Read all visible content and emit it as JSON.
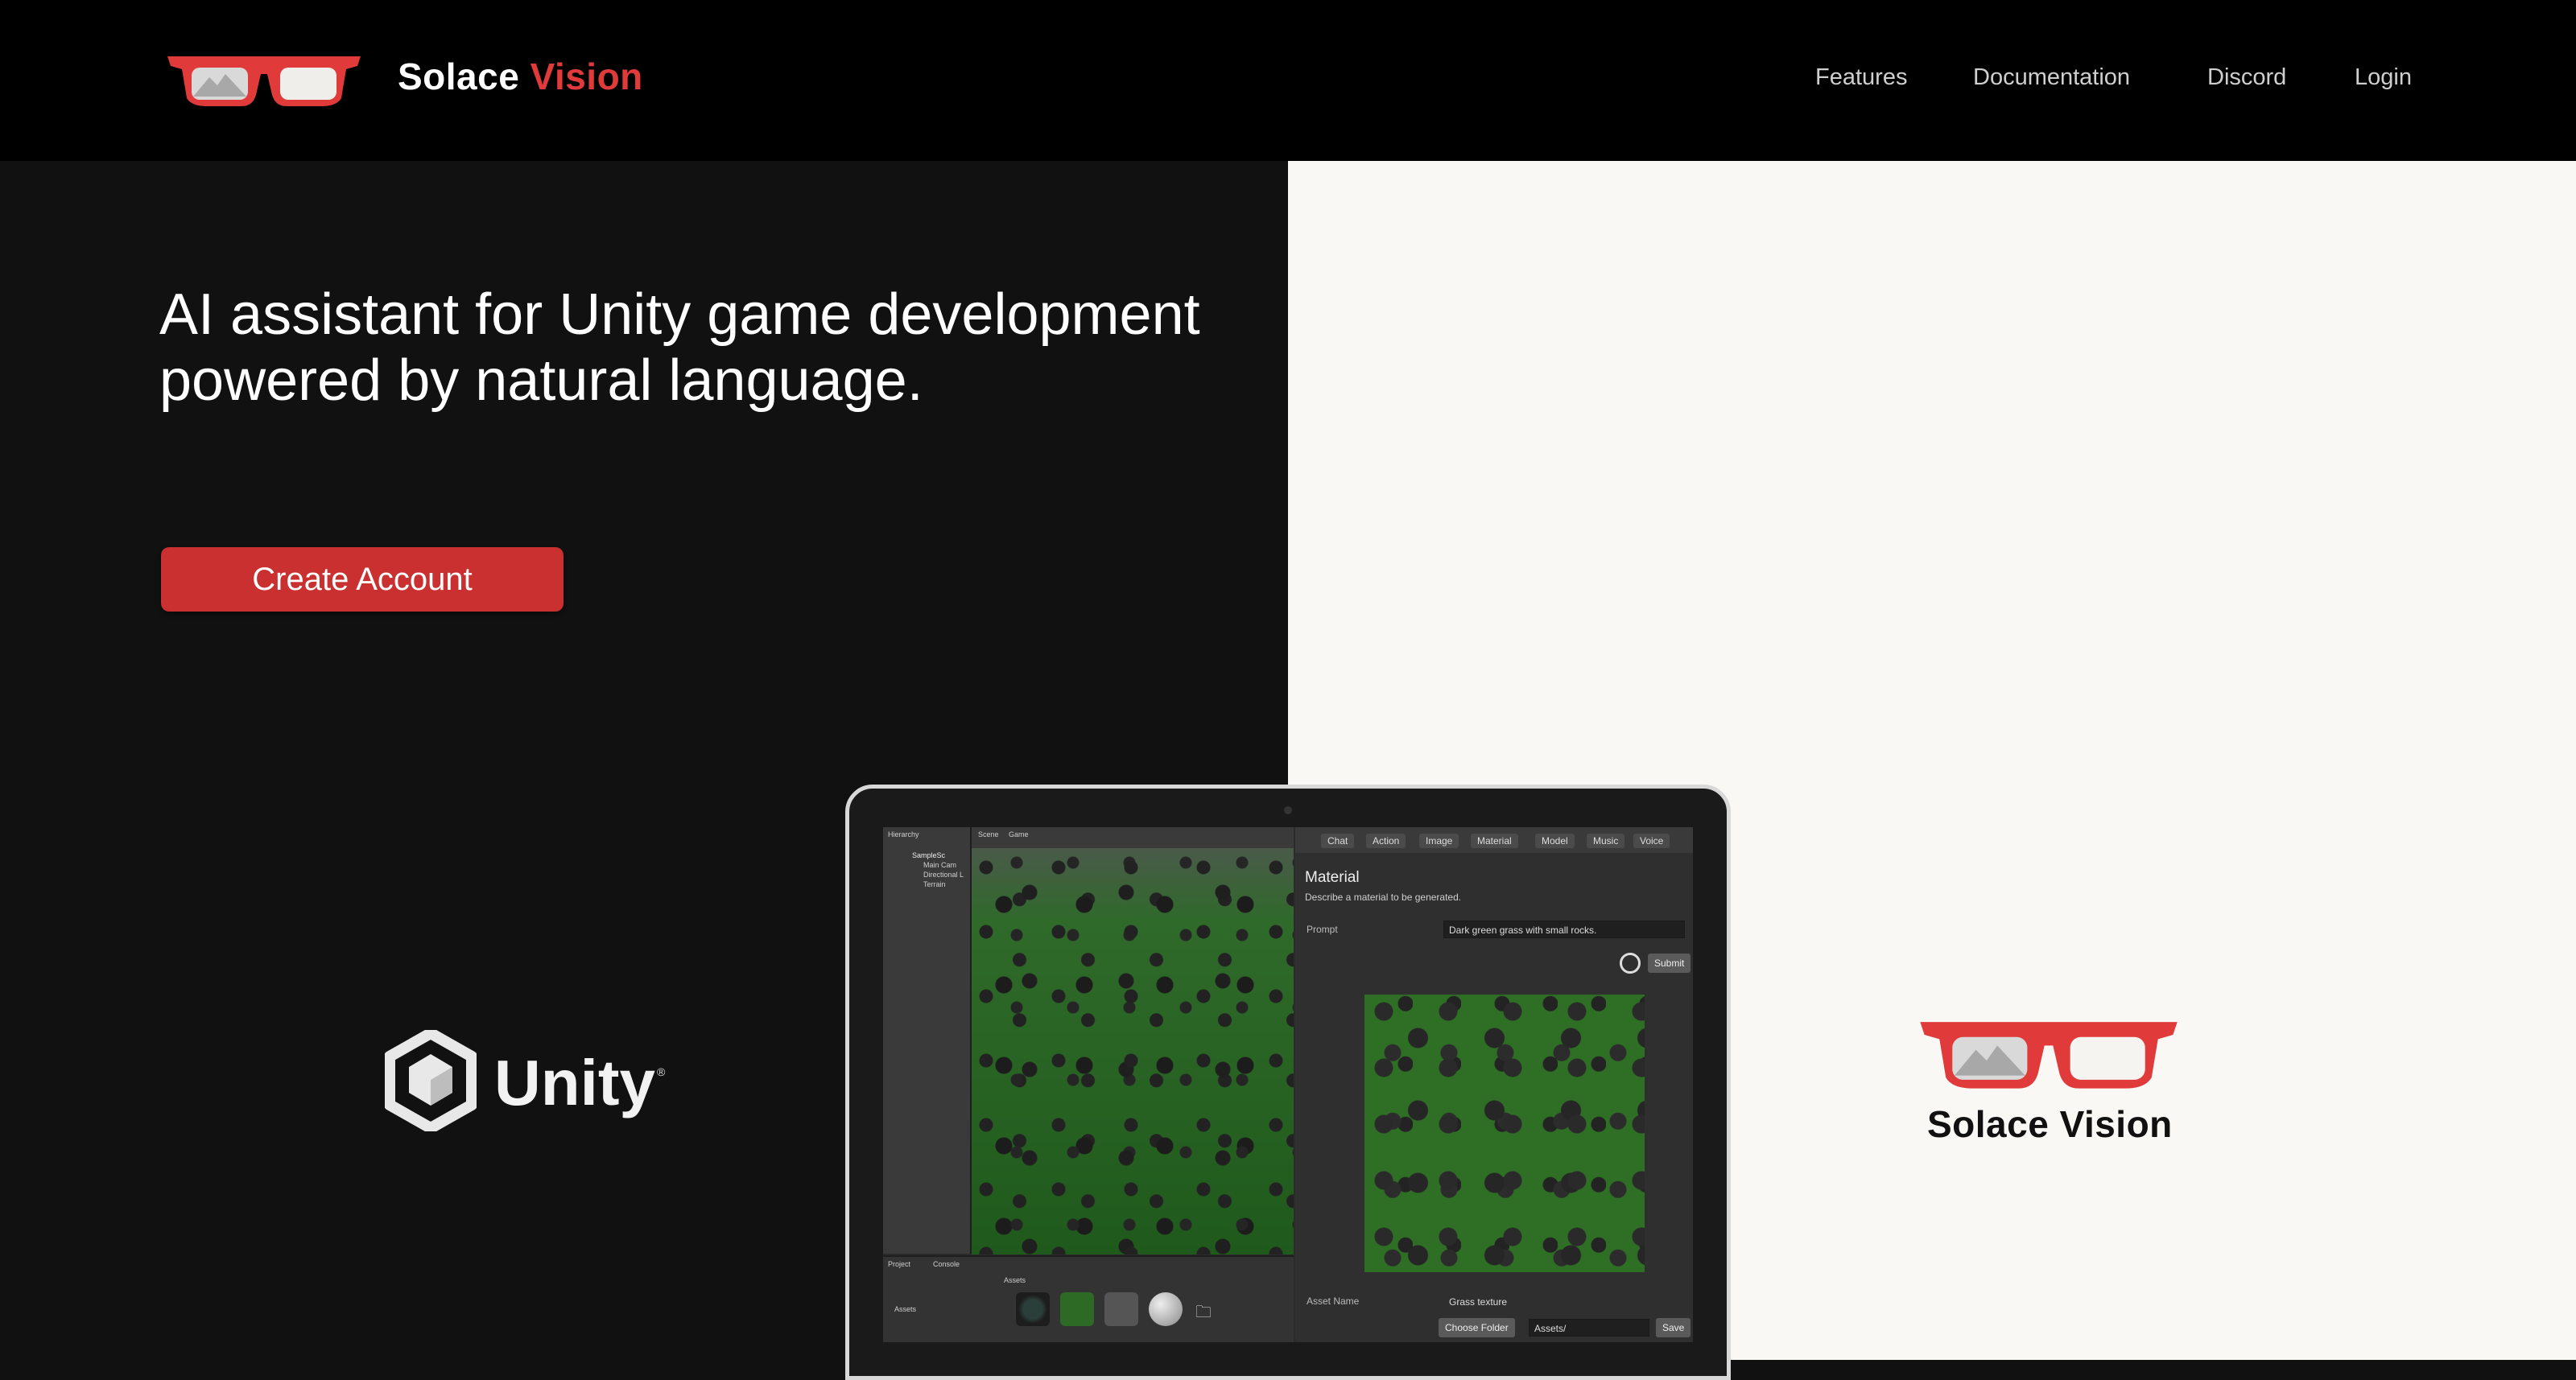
{
  "brand": {
    "name_part1": "Solace",
    "name_part2": "Vision"
  },
  "nav": {
    "links": [
      "Features",
      "Documentation",
      "Discord",
      "Login"
    ]
  },
  "hero": {
    "headline_line1": "AI assistant for Unity game development",
    "headline_line2": "powered by natural language.",
    "cta_label": "Create Account"
  },
  "unity_logo": {
    "text": "Unity"
  },
  "right_logo": {
    "text": "Solace Vision"
  },
  "colors": {
    "accent": "#e03a3a",
    "cta": "#c9302f",
    "dark_bg": "#111111",
    "light_bg": "#faf8f4"
  },
  "editor": {
    "hierarchy_tab": "Hierarchy",
    "scene_tab": "Scene",
    "game_tab": "Game",
    "project_tab": "Project",
    "console_tab": "Console",
    "hierarchy_items": [
      "SampleSc",
      "Main Cam",
      "Directional L",
      "Terrain"
    ],
    "assets_label": "Assets",
    "panel": {
      "tabs": [
        "Chat",
        "Action",
        "Image",
        "Material",
        "Model",
        "Music",
        "Voice"
      ],
      "title": "Material",
      "description": "Describe a material to be generated.",
      "prompt_label": "Prompt",
      "prompt_value": "Dark green grass with small rocks.",
      "submit_label": "Submit",
      "asset_name_label": "Asset Name",
      "asset_name_value": "Grass texture",
      "choose_folder_label": "Choose Folder",
      "folder_value": "Assets/",
      "save_label": "Save"
    }
  }
}
